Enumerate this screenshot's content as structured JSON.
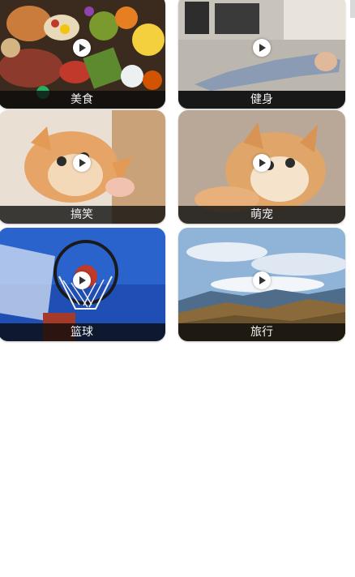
{
  "categories": [
    {
      "label": "美食",
      "icon": "play-icon"
    },
    {
      "label": "健身",
      "icon": "play-icon"
    },
    {
      "label": "搞笑",
      "icon": "play-icon"
    },
    {
      "label": "萌宠",
      "icon": "play-icon"
    },
    {
      "label": "篮球",
      "icon": "play-icon"
    },
    {
      "label": "旅行",
      "icon": "play-icon"
    }
  ]
}
